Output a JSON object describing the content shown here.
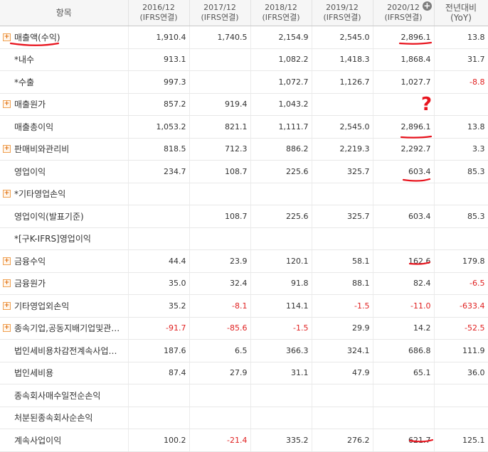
{
  "header": {
    "item_col": "항목",
    "periods": [
      {
        "year": "2016/12",
        "basis": "(IFRS연결)"
      },
      {
        "year": "2017/12",
        "basis": "(IFRS연결)"
      },
      {
        "year": "2018/12",
        "basis": "(IFRS연결)"
      },
      {
        "year": "2019/12",
        "basis": "(IFRS연결)"
      },
      {
        "year": "2020/12",
        "basis": "(IFRS연결)"
      }
    ],
    "yoy_line1": "전년대비",
    "yoy_line2": "(YoY)",
    "add_column_glyph": "+"
  },
  "rows": [
    {
      "label": "매출액(수익)",
      "expandable": true,
      "values": [
        "1,910.4",
        "1,740.5",
        "2,154.9",
        "2,545.0",
        "2,896.1"
      ],
      "yoy": "13.8"
    },
    {
      "label": "*내수",
      "expandable": false,
      "values": [
        "913.1",
        "",
        "1,082.2",
        "1,418.3",
        "1,868.4"
      ],
      "yoy": "31.7"
    },
    {
      "label": "*수출",
      "expandable": false,
      "values": [
        "997.3",
        "",
        "1,072.7",
        "1,126.7",
        "1,027.7"
      ],
      "yoy": "-8.8"
    },
    {
      "label": "매출원가",
      "expandable": true,
      "values": [
        "857.2",
        "919.4",
        "1,043.2",
        "",
        ""
      ],
      "yoy": ""
    },
    {
      "label": "매출총이익",
      "expandable": false,
      "values": [
        "1,053.2",
        "821.1",
        "1,111.7",
        "2,545.0",
        "2,896.1"
      ],
      "yoy": "13.8"
    },
    {
      "label": "판매비와관리비",
      "expandable": true,
      "values": [
        "818.5",
        "712.3",
        "886.2",
        "2,219.3",
        "2,292.7"
      ],
      "yoy": "3.3"
    },
    {
      "label": "영업이익",
      "expandable": false,
      "values": [
        "234.7",
        "108.7",
        "225.6",
        "325.7",
        "603.4"
      ],
      "yoy": "85.3"
    },
    {
      "label": "*기타영업손익",
      "expandable": true,
      "values": [
        "",
        "",
        "",
        "",
        ""
      ],
      "yoy": ""
    },
    {
      "label": "영업이익(발표기준)",
      "expandable": false,
      "values": [
        "",
        "108.7",
        "225.6",
        "325.7",
        "603.4"
      ],
      "yoy": "85.3"
    },
    {
      "label": "*[구K-IFRS]영업이익",
      "expandable": false,
      "values": [
        "",
        "",
        "",
        "",
        ""
      ],
      "yoy": ""
    },
    {
      "label": "금융수익",
      "expandable": true,
      "values": [
        "44.4",
        "23.9",
        "120.1",
        "58.1",
        "162.6"
      ],
      "yoy": "179.8"
    },
    {
      "label": "금융원가",
      "expandable": true,
      "values": [
        "35.0",
        "32.4",
        "91.8",
        "88.1",
        "82.4"
      ],
      "yoy": "-6.5"
    },
    {
      "label": "기타영업외손익",
      "expandable": true,
      "values": [
        "35.2",
        "-8.1",
        "114.1",
        "-1.5",
        "-11.0"
      ],
      "yoy": "-633.4"
    },
    {
      "label": "종속기업,공동지배기업및관…",
      "expandable": true,
      "values": [
        "-91.7",
        "-85.6",
        "-1.5",
        "29.9",
        "14.2"
      ],
      "yoy": "-52.5"
    },
    {
      "label": "법인세비용차감전계속사업…",
      "expandable": false,
      "values": [
        "187.6",
        "6.5",
        "366.3",
        "324.1",
        "686.8"
      ],
      "yoy": "111.9"
    },
    {
      "label": "법인세비용",
      "expandable": false,
      "values": [
        "87.4",
        "27.9",
        "31.1",
        "47.9",
        "65.1"
      ],
      "yoy": "36.0"
    },
    {
      "label": "종속회사매수일전순손익",
      "expandable": false,
      "values": [
        "",
        "",
        "",
        "",
        ""
      ],
      "yoy": ""
    },
    {
      "label": "처분된종속회사순손익",
      "expandable": false,
      "values": [
        "",
        "",
        "",
        "",
        ""
      ],
      "yoy": ""
    },
    {
      "label": "계속사업이익",
      "expandable": false,
      "values": [
        "100.2",
        "-21.4",
        "335.2",
        "276.2",
        "621.7"
      ],
      "yoy": "125.1"
    }
  ],
  "annotations": {
    "color": "#e8141e",
    "question_mark": "?"
  },
  "colors": {
    "negative": "#e02020",
    "expand_icon": "#e07010"
  }
}
